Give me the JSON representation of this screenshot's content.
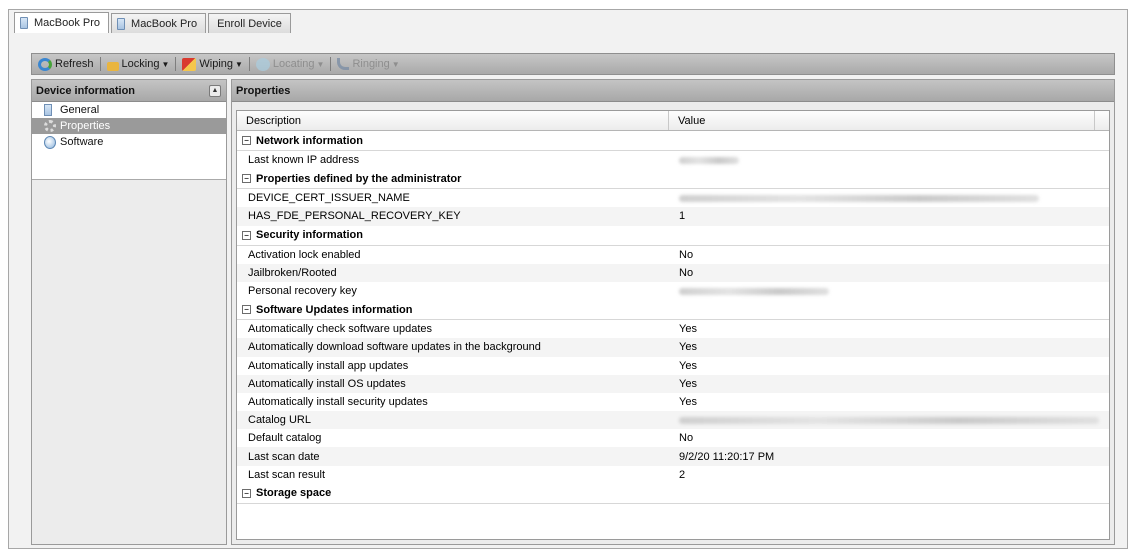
{
  "tabs": [
    {
      "label": "MacBook Pro",
      "active": true,
      "icon": "device-icon"
    },
    {
      "label": "MacBook Pro",
      "active": false,
      "icon": "device-icon"
    },
    {
      "label": "Enroll Device",
      "active": false
    }
  ],
  "toolbar": {
    "refresh_label": "Refresh",
    "locking_label": "Locking",
    "wiping_label": "Wiping",
    "locating_label": "Locating",
    "ringing_label": "Ringing"
  },
  "left_panel": {
    "title": "Device information",
    "items": [
      {
        "label": "General",
        "icon": "device-icon",
        "selected": false
      },
      {
        "label": "Properties",
        "icon": "gear-icon",
        "selected": true
      },
      {
        "label": "Software",
        "icon": "software-icon",
        "selected": false
      }
    ]
  },
  "right_panel": {
    "title": "Properties",
    "columns": {
      "description": "Description",
      "value": "Value"
    },
    "groups": [
      {
        "title": "Network information",
        "rows": [
          {
            "description": "Last known IP address",
            "value": "",
            "redacted": true
          }
        ]
      },
      {
        "title": "Properties defined by the administrator",
        "rows": [
          {
            "description": "DEVICE_CERT_ISSUER_NAME",
            "value": "",
            "redacted": true
          },
          {
            "description": "HAS_FDE_PERSONAL_RECOVERY_KEY",
            "value": "1"
          }
        ]
      },
      {
        "title": "Security information",
        "rows": [
          {
            "description": "Activation lock enabled",
            "value": "No"
          },
          {
            "description": "Jailbroken/Rooted",
            "value": "No"
          },
          {
            "description": "Personal recovery key",
            "value": "",
            "redacted": true
          }
        ]
      },
      {
        "title": "Software Updates information",
        "rows": [
          {
            "description": "Automatically check software updates",
            "value": "Yes"
          },
          {
            "description": "Automatically download software updates in the background",
            "value": "Yes"
          },
          {
            "description": "Automatically install app updates",
            "value": "Yes"
          },
          {
            "description": "Automatically install OS updates",
            "value": "Yes"
          },
          {
            "description": "Automatically install security updates",
            "value": "Yes"
          },
          {
            "description": "Catalog URL",
            "value": "",
            "redacted": true
          },
          {
            "description": "Default catalog",
            "value": "No"
          },
          {
            "description": "Last scan date",
            "value": "9/2/20 11:20:17 PM"
          },
          {
            "description": "Last scan result",
            "value": "2"
          }
        ]
      },
      {
        "title": "Storage space",
        "rows": []
      }
    ]
  }
}
